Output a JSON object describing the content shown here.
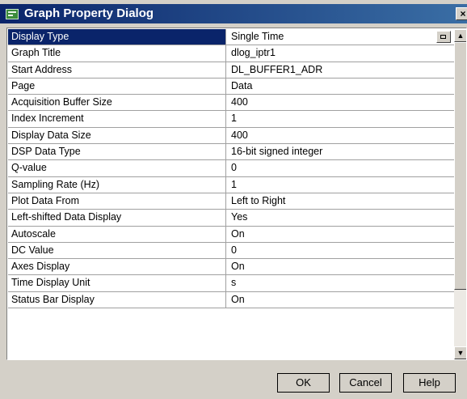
{
  "window": {
    "title": "Graph Property Dialog",
    "icon": "graph-app-icon",
    "close_glyph": "×"
  },
  "properties": [
    {
      "name": "Display Type",
      "value": "Single Time",
      "selected": true,
      "has_dropdown": true
    },
    {
      "name": "Graph Title",
      "value": "dlog_iptr1"
    },
    {
      "name": "Start Address",
      "value": "DL_BUFFER1_ADR"
    },
    {
      "name": "Page",
      "value": "Data"
    },
    {
      "name": "Acquisition Buffer Size",
      "value": "400"
    },
    {
      "name": "Index Increment",
      "value": "1"
    },
    {
      "name": "Display Data Size",
      "value": "400"
    },
    {
      "name": "DSP Data Type",
      "value": "16-bit signed integer"
    },
    {
      "name": "Q-value",
      "value": "0"
    },
    {
      "name": "Sampling Rate (Hz)",
      "value": "1"
    },
    {
      "name": "Plot Data From",
      "value": "Left to Right"
    },
    {
      "name": "Left-shifted Data Display",
      "value": "Yes"
    },
    {
      "name": "Autoscale",
      "value": "On"
    },
    {
      "name": "DC Value",
      "value": "0"
    },
    {
      "name": "Axes Display",
      "value": "On"
    },
    {
      "name": "Time Display Unit",
      "value": "s"
    },
    {
      "name": "Status Bar Display",
      "value": "On"
    }
  ],
  "scrollbar": {
    "up_glyph": "▲",
    "down_glyph": "▼"
  },
  "buttons": {
    "ok": "OK",
    "cancel": "Cancel",
    "help": "Help"
  },
  "colors": {
    "selection": "#0a246a",
    "dialog_face": "#d4d0c8",
    "title_gradient_end": "#3a6ea5"
  }
}
